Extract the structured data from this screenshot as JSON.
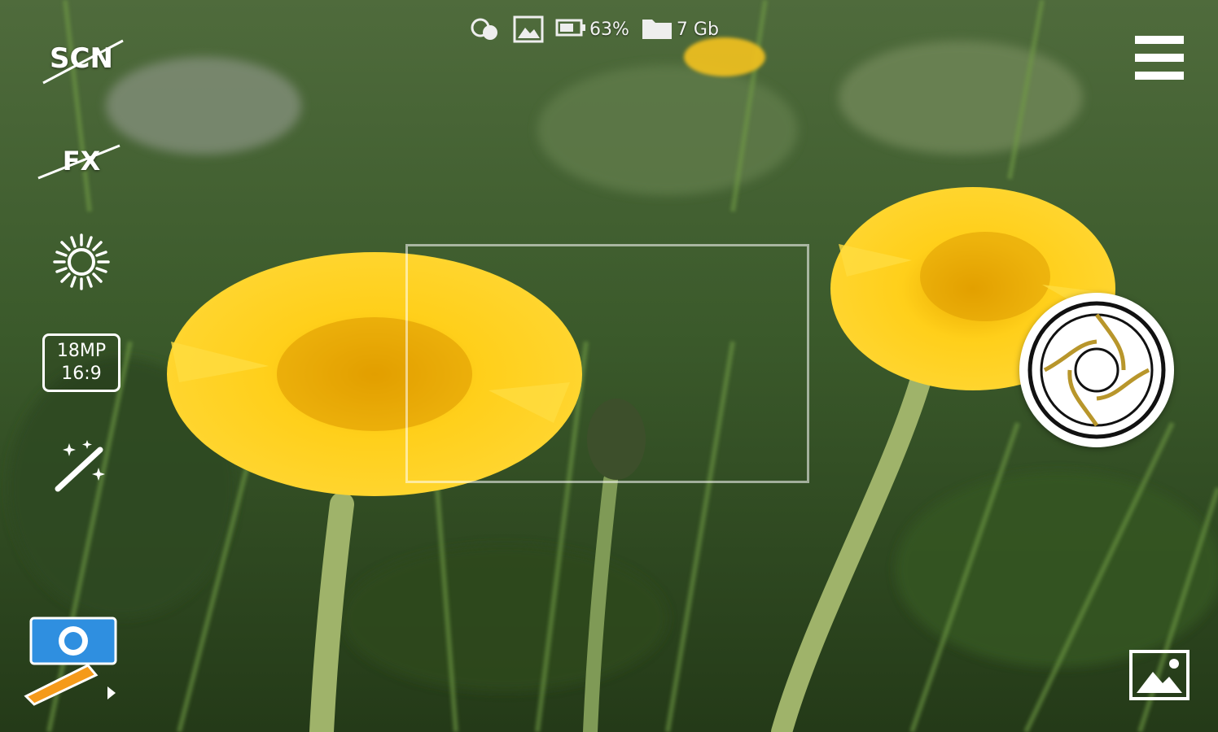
{
  "status_bar": {
    "battery_percent": "63%",
    "storage_free": "7 Gb"
  },
  "left_toolbar": {
    "scene_label": "SCN",
    "effects_label": "FX",
    "resolution_mp": "18MP",
    "aspect_ratio": "16:9"
  },
  "icons": {
    "status": [
      "cloud-sync-icon",
      "image-icon",
      "battery-icon",
      "folder-icon"
    ],
    "left_toolbar": [
      "scene-mode-icon",
      "effects-icon",
      "brightness-icon",
      "resolution-icon",
      "magic-wand-icon",
      "camera-mode-switch-icon"
    ],
    "right_toolbar": [
      "menu-icon",
      "shutter-icon",
      "gallery-icon"
    ]
  },
  "colors": {
    "shutter_gold": "#b8962b",
    "mode_switch_blue": "#2f8fe0",
    "mode_switch_orange": "#f59a1a"
  }
}
